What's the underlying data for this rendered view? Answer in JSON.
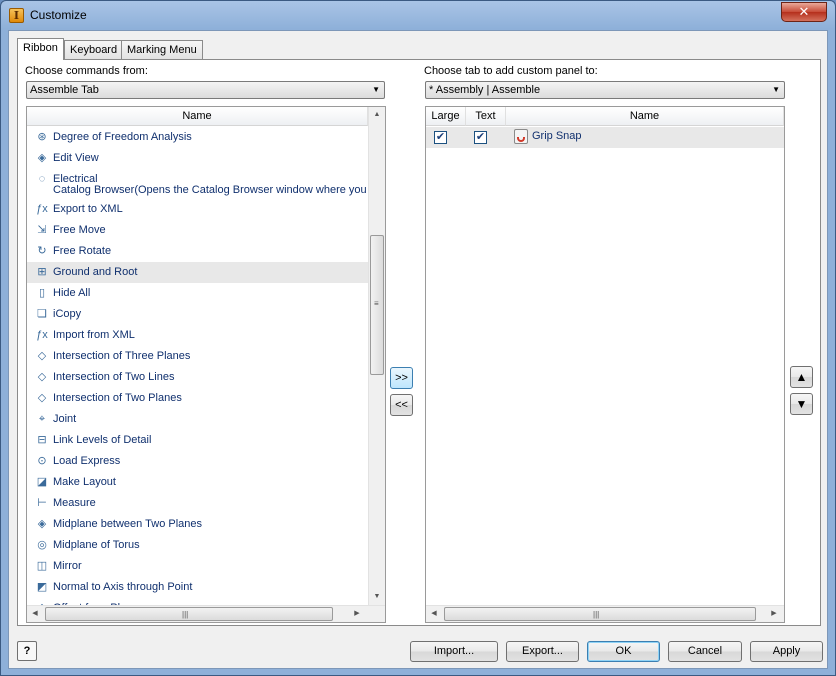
{
  "window": {
    "title": "Customize",
    "app_icon_letter": "I",
    "close_glyph": "✕"
  },
  "tabs": [
    {
      "label": "Ribbon",
      "active": true
    },
    {
      "label": "Keyboard",
      "active": false
    },
    {
      "label": "Marking Menu",
      "active": false
    }
  ],
  "left": {
    "label": "Choose commands from:",
    "combo_value": "Assemble Tab",
    "column_header": "Name",
    "items": [
      {
        "label": "Degree of Freedom Analysis",
        "icon": "dof-icon",
        "glyph": "⊛"
      },
      {
        "label": "Edit View",
        "icon": "edit-view-icon",
        "glyph": "◈"
      },
      {
        "label": "Electrical",
        "label2": "Catalog Browser(Opens the Catalog Browser window where you ca",
        "icon": "electrical-icon",
        "glyph": "◌"
      },
      {
        "label": "Export to XML",
        "icon": "export-xml-icon",
        "glyph": "ƒx"
      },
      {
        "label": "Free Move",
        "icon": "free-move-icon",
        "glyph": "⇲"
      },
      {
        "label": "Free Rotate",
        "icon": "free-rotate-icon",
        "glyph": "↻"
      },
      {
        "label": "Ground and Root",
        "icon": "ground-root-icon",
        "glyph": "⊞"
      },
      {
        "label": "Hide All",
        "icon": "hide-all-icon",
        "glyph": "▯"
      },
      {
        "label": "iCopy",
        "icon": "icopy-icon",
        "glyph": "❏"
      },
      {
        "label": "Import from XML",
        "icon": "import-xml-icon",
        "glyph": "ƒx"
      },
      {
        "label": "Intersection of Three Planes",
        "icon": "intersection-three-planes-icon",
        "glyph": "◇"
      },
      {
        "label": "Intersection of Two Lines",
        "icon": "intersection-two-lines-icon",
        "glyph": "◇"
      },
      {
        "label": "Intersection of Two Planes",
        "icon": "intersection-two-planes-icon",
        "glyph": "◇"
      },
      {
        "label": "Joint",
        "icon": "joint-icon",
        "glyph": "⌖"
      },
      {
        "label": "Link Levels of Detail",
        "icon": "link-lod-icon",
        "glyph": "⊟"
      },
      {
        "label": "Load Express",
        "icon": "load-express-icon",
        "glyph": "⊙"
      },
      {
        "label": "Make Layout",
        "icon": "make-layout-icon",
        "glyph": "◪"
      },
      {
        "label": "Measure",
        "icon": "measure-icon",
        "glyph": "⊢"
      },
      {
        "label": "Midplane between Two Planes",
        "icon": "midplane-two-planes-icon",
        "glyph": "◈"
      },
      {
        "label": "Midplane of Torus",
        "icon": "midplane-torus-icon",
        "glyph": "◎"
      },
      {
        "label": "Mirror",
        "icon": "mirror-icon",
        "glyph": "◫"
      },
      {
        "label": "Normal to Axis through Point",
        "icon": "normal-axis-point-icon",
        "glyph": "◩"
      },
      {
        "label": "Offset from Plane",
        "icon": "offset-plane-icon",
        "glyph": "◇"
      }
    ],
    "selected_index": 6
  },
  "right": {
    "label": "Choose tab to add custom panel to:",
    "combo_value": "* Assembly | Assemble",
    "columns": {
      "large": "Large",
      "text": "Text",
      "name": "Name"
    },
    "rows": [
      {
        "large": true,
        "text": true,
        "name": "Grip Snap",
        "icon": "grip-snap-icon"
      }
    ]
  },
  "transfer": {
    "add": ">>",
    "remove": "<<"
  },
  "move": {
    "up": "▲",
    "down": "▼"
  },
  "scroll": {
    "up": "▲",
    "down": "▼",
    "left": "◀",
    "right": "▶",
    "grip_v": "≡",
    "grip_h": "|||"
  },
  "check_glyph": "✔",
  "buttons": {
    "help": "?",
    "import": "Import...",
    "export": "Export...",
    "ok": "OK",
    "cancel": "Cancel",
    "apply": "Apply"
  }
}
